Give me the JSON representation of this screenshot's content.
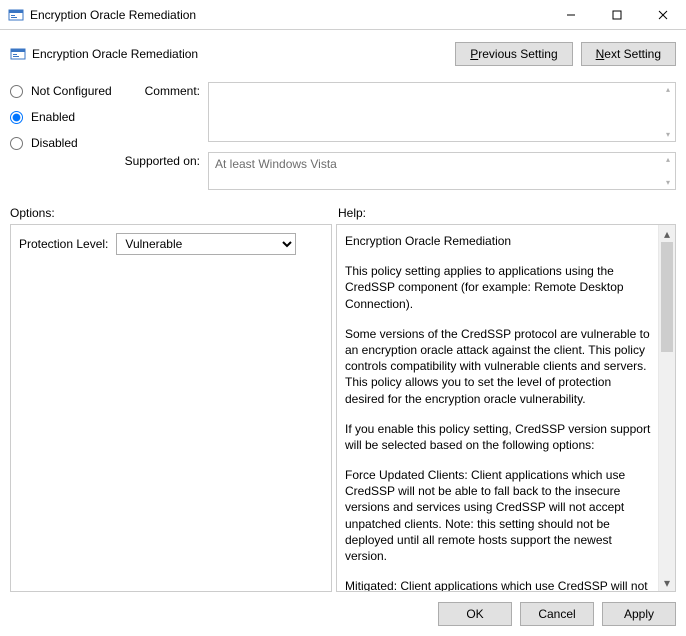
{
  "window": {
    "title": "Encryption Oracle Remediation",
    "headerTitle": "Encryption Oracle Remediation"
  },
  "buttons": {
    "prevSetting": "Previous Setting",
    "nextSetting": "Next Setting",
    "ok": "OK",
    "cancel": "Cancel",
    "apply": "Apply"
  },
  "state": {
    "notConfigured": "Not Configured",
    "enabled": "Enabled",
    "disabled": "Disabled",
    "selected": "enabled"
  },
  "fields": {
    "commentLabel": "Comment:",
    "commentValue": "",
    "supportedLabel": "Supported on:",
    "supportedValue": "At least Windows Vista"
  },
  "sections": {
    "optionsLabel": "Options:",
    "helpLabel": "Help:"
  },
  "options": {
    "protectionLabel": "Protection Level:",
    "protectionValue": "Vulnerable",
    "protectionChoices": [
      "Vulnerable"
    ]
  },
  "help": {
    "title": "Encryption Oracle Remediation",
    "p1": "This policy setting applies to applications using the CredSSP component (for example: Remote Desktop Connection).",
    "p2": "Some versions of the CredSSP protocol are vulnerable to an encryption oracle attack against the client.  This policy controls compatibility with vulnerable clients and servers.  This policy allows you to set the level of protection desired for the encryption oracle vulnerability.",
    "p3": "If you enable this policy setting, CredSSP version support will be selected based on the following options:",
    "p4": "Force Updated Clients: Client applications which use CredSSP will not be able to fall back to the insecure versions and services using CredSSP will not accept unpatched clients. Note: this setting should not be deployed until all remote hosts support the newest version.",
    "p5": "Mitigated: Client applications which use CredSSP will not be able"
  }
}
